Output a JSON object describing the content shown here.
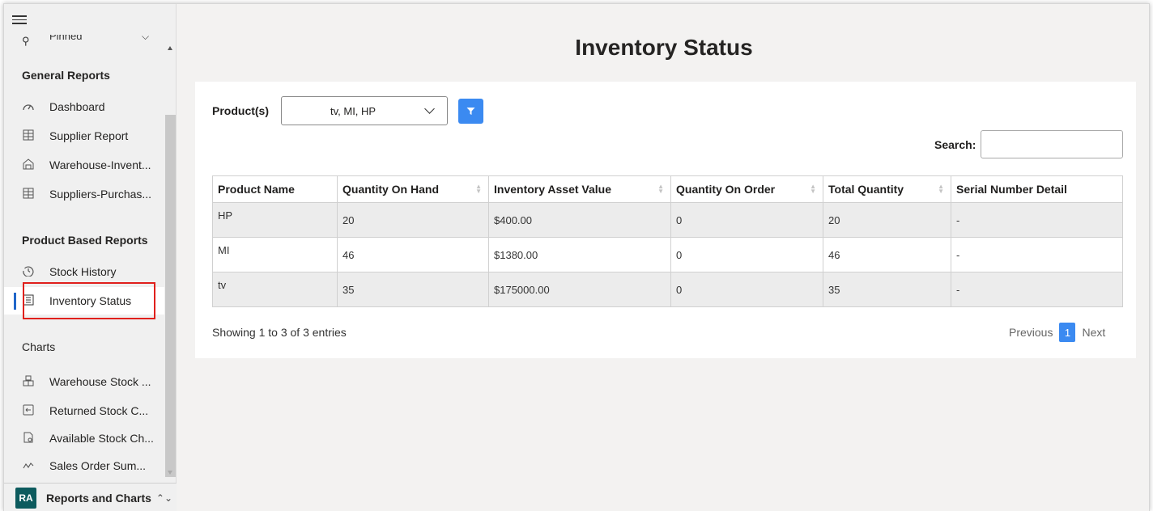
{
  "sidebar": {
    "pinned_label": "Pinned",
    "sections": [
      {
        "title": "General Reports",
        "items": [
          {
            "label": "Dashboard",
            "icon": "gauge-icon"
          },
          {
            "label": "Supplier Report",
            "icon": "grid-table-icon"
          },
          {
            "label": "Warehouse-Invent...",
            "icon": "warehouse-icon"
          },
          {
            "label": "Suppliers-Purchas...",
            "icon": "grid-table-icon"
          }
        ]
      },
      {
        "title": "Product Based Reports",
        "items": [
          {
            "label": "Stock History",
            "icon": "history-icon"
          },
          {
            "label": "Inventory Status",
            "icon": "report-list-icon",
            "active": true
          }
        ]
      },
      {
        "title": "Charts",
        "items": [
          {
            "label": "Warehouse Stock ...",
            "icon": "boxes-icon"
          },
          {
            "label": "Returned Stock C...",
            "icon": "return-box-icon"
          },
          {
            "label": "Available Stock Ch...",
            "icon": "document-chart-icon"
          },
          {
            "label": "Sales Order Sum...",
            "icon": "line-chart-icon"
          }
        ]
      }
    ],
    "footer": {
      "avatar": "RA",
      "app_name": "Reports and Charts"
    }
  },
  "main": {
    "title": "Inventory Status",
    "filter": {
      "label": "Product(s)",
      "value": "tv, MI, HP"
    },
    "search": {
      "label": "Search:",
      "value": ""
    },
    "table": {
      "headers": [
        "Product Name",
        "Quantity On Hand",
        "Inventory Asset Value",
        "Quantity On Order",
        "Total Quantity",
        "Serial Number Detail"
      ],
      "rows": [
        [
          "HP",
          "20",
          "$400.00",
          "0",
          "20",
          "-"
        ],
        [
          "MI",
          "46",
          "$1380.00",
          "0",
          "46",
          "-"
        ],
        [
          "tv",
          "35",
          "$175000.00",
          "0",
          "35",
          "-"
        ]
      ]
    },
    "info": "Showing 1 to 3 of 3 entries",
    "pager": {
      "previous": "Previous",
      "current": "1",
      "next": "Next"
    }
  },
  "colors": {
    "accent": "#3b8af1",
    "active_bar": "#2066c9",
    "highlight": "#e0201c",
    "avatar_bg": "#0d5b5e"
  }
}
